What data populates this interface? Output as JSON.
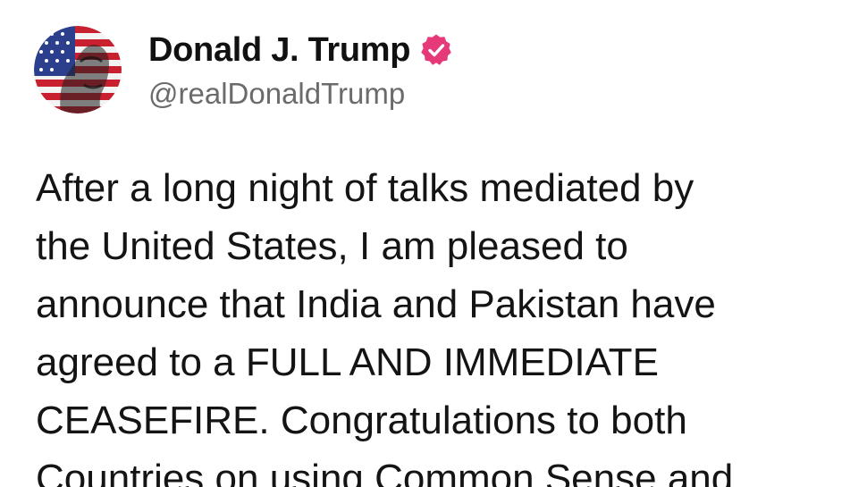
{
  "post": {
    "author": {
      "display_name": "Donald J. Trump",
      "handle": "@realDonaldTrump",
      "verified": true,
      "verified_badge_color": "#e5397a",
      "avatar_icon": "flag-portrait-avatar"
    },
    "text_lines": [
      "After a long night of talks mediated by",
      "the United States, I am pleased to",
      "announce that India and Pakistan have",
      "agreed to a FULL AND IMMEDIATE",
      "CEASEFIRE. Congratulations to both",
      "Countries on using Common Sense and"
    ]
  }
}
